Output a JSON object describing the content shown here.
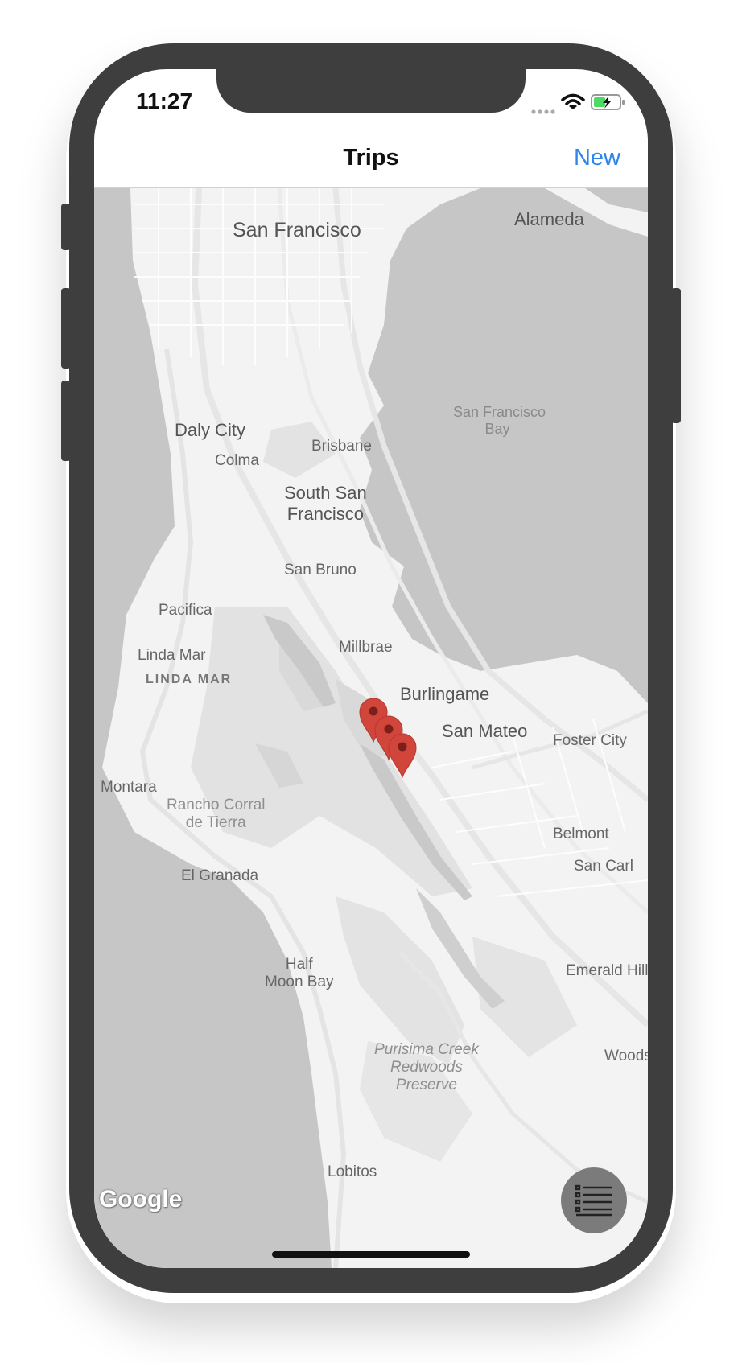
{
  "status_bar": {
    "time": "11:27"
  },
  "navbar": {
    "title": "Trips",
    "new_label": "New"
  },
  "map": {
    "labels": {
      "san_francisco": "San Francisco",
      "alameda": "Alameda",
      "sf_bay_1": "San Francisco",
      "sf_bay_2": "Bay",
      "daly_city": "Daly City",
      "brisbane": "Brisbane",
      "colma": "Colma",
      "south_sf_1": "South San",
      "south_sf_2": "Francisco",
      "san_bruno": "San Bruno",
      "pacifica": "Pacifica",
      "millbrae": "Millbrae",
      "linda_mar": "Linda Mar",
      "linda_mar_caps": "LINDA MAR",
      "burlingame": "Burlingame",
      "san_mateo": "San Mateo",
      "foster_city": "Foster City",
      "montara": "Montara",
      "rancho_1": "Rancho Corral",
      "rancho_2": "de Tierra",
      "belmont": "Belmont",
      "san_carlos": "San Carl",
      "el_granada": "El Granada",
      "half_moon_1": "Half",
      "half_moon_2": "Moon Bay",
      "emerald_hills": "Emerald Hill",
      "purisima_1": "Purisima Creek",
      "purisima_2": "Redwoods",
      "purisima_3": "Preserve",
      "woodside": "Woods",
      "lobitos": "Lobitos"
    },
    "attribution": "Google",
    "markers": 3,
    "colors": {
      "water": "#c6c6c6",
      "land": "#f3f3f3",
      "marker": "#d2453a"
    }
  },
  "fab": {
    "icon": "list-icon"
  }
}
